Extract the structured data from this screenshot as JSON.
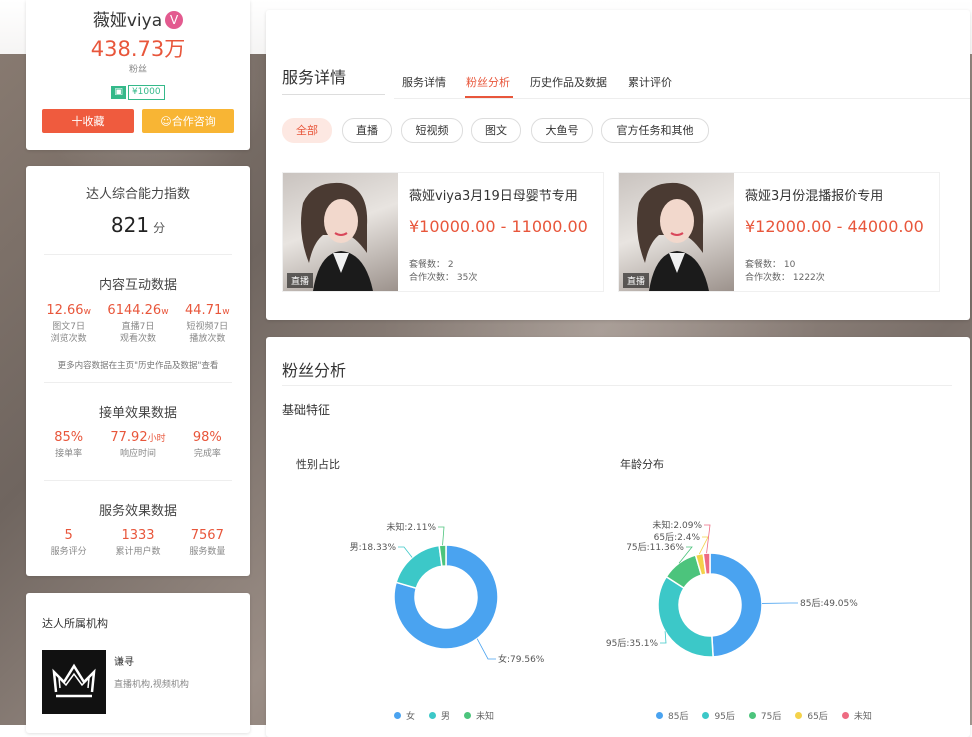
{
  "profile": {
    "name": "薇娅viya",
    "verified_badge": "V",
    "fans_count": "438.73万",
    "fans_label": "粉丝",
    "price_tag": "¥1000",
    "favorite_button": "十收藏",
    "consult_button": "合作咨询"
  },
  "ability": {
    "title": "达人综合能力指数",
    "score": "821",
    "score_unit": "分"
  },
  "content_interaction": {
    "title": "内容互动数据",
    "items": [
      {
        "value": "12.66",
        "unit": "w",
        "label1": "图文7日",
        "label2": "浏览次数"
      },
      {
        "value": "6144.26",
        "unit": "w",
        "label1": "直播7日",
        "label2": "观看次数"
      },
      {
        "value": "44.71",
        "unit": "w",
        "label1": "短视频7日",
        "label2": "播放次数"
      }
    ],
    "note": "更多内容数据在主页\"历史作品及数据\"查看"
  },
  "order_effect": {
    "title": "接单效果数据",
    "items": [
      {
        "value": "85%",
        "unit": "",
        "label": "接单率"
      },
      {
        "value": "77.92",
        "unit": "小时",
        "label": "响应时间"
      },
      {
        "value": "98%",
        "unit": "",
        "label": "完成率"
      }
    ]
  },
  "service_effect": {
    "title": "服务效果数据",
    "items": [
      {
        "value": "5",
        "label": "服务评分"
      },
      {
        "value": "1333",
        "label": "累计用户数"
      },
      {
        "value": "7567",
        "label": "服务数量"
      }
    ]
  },
  "org": {
    "title": "达人所属机构",
    "name": "谦寻",
    "type": "直播机构,视频机构"
  },
  "services": {
    "title": "服务详情",
    "tabs": [
      "服务详情",
      "粉丝分析",
      "历史作品及数据",
      "累计评价"
    ],
    "active_tab": "粉丝分析",
    "chips": [
      "全部",
      "直播",
      "短视频",
      "图文",
      "大鱼号",
      "官方任务和其他"
    ],
    "cards": [
      {
        "name": "薇娅viya3月19日母婴节专用",
        "price": "¥10000.00 - 11000.00",
        "packages": "套餐数：  2",
        "coop": "合作次数：  35次",
        "tag": "直播"
      },
      {
        "name": "薇娅3月份混播报价专用",
        "price": "¥12000.00 - 44000.00",
        "packages": "套餐数：  10",
        "coop": "合作次数：  1222次",
        "tag": "直播"
      }
    ]
  },
  "fans": {
    "title": "粉丝分析",
    "subtitle": "基础特征",
    "gender_title": "性别占比",
    "age_title": "年龄分布"
  },
  "colors": {
    "accent": "#e8563b",
    "blue": "#4aa3f0",
    "teal": "#3cc8c8",
    "green": "#4cc47c",
    "yellow": "#f4d24a",
    "pink": "#ee6b82"
  },
  "chart_data": [
    {
      "type": "pie",
      "title": "性别占比",
      "categories": [
        "女",
        "男",
        "未知"
      ],
      "values": [
        79.56,
        18.33,
        2.11
      ],
      "labels": [
        "女:79.56%",
        "男:18.33%",
        "未知:2.11%"
      ],
      "colors": [
        "#4aa3f0",
        "#3cc8c8",
        "#4cc47c"
      ],
      "legend": "bottom"
    },
    {
      "type": "pie",
      "title": "年龄分布",
      "categories": [
        "85后",
        "95后",
        "75后",
        "65后",
        "未知"
      ],
      "values": [
        49.05,
        35.1,
        11.36,
        2.4,
        2.09
      ],
      "labels": [
        "85后:49.05%",
        "95后:35.1%",
        "75后:11.36%",
        "65后:2.4%",
        "未知:2.09%"
      ],
      "colors": [
        "#4aa3f0",
        "#3cc8c8",
        "#4cc47c",
        "#f4d24a",
        "#ee6b82"
      ],
      "legend": "bottom"
    }
  ]
}
